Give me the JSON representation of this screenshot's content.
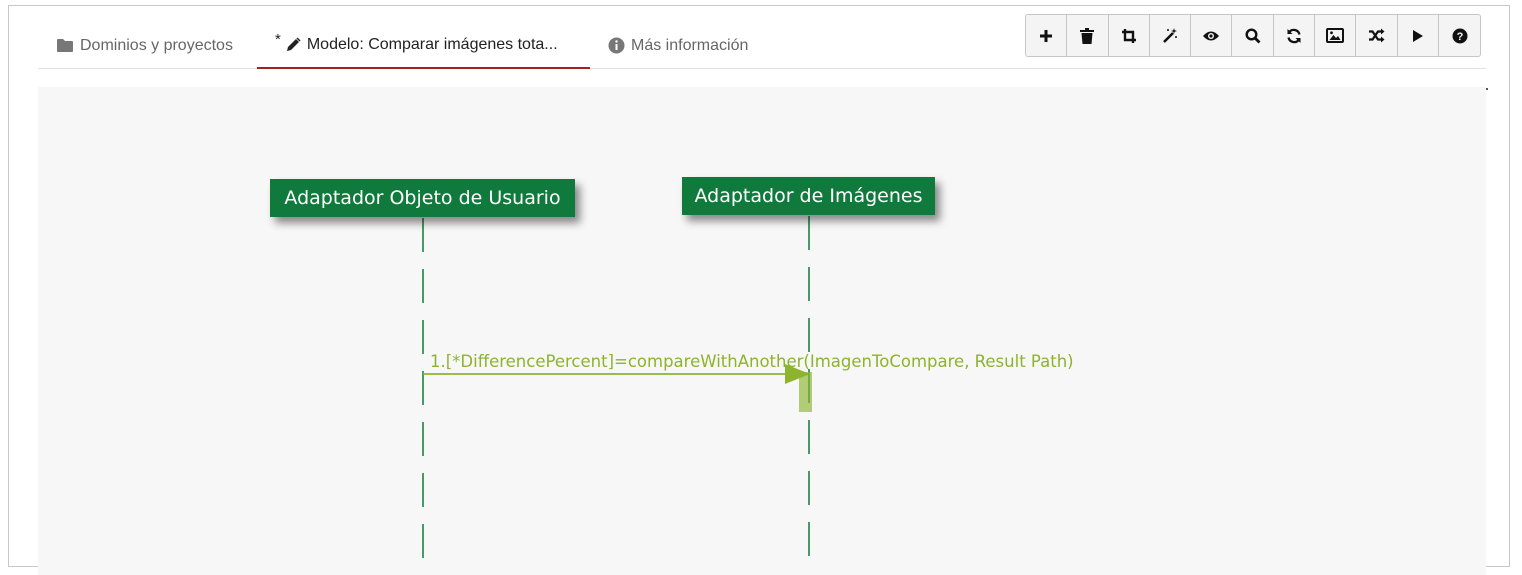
{
  "tabs": [
    {
      "label": "Dominios y proyectos",
      "icon": "folder-icon"
    },
    {
      "label": "Modelo: Comparar imágenes tota...",
      "icon": "pencil-icon",
      "modified_marker": "*"
    },
    {
      "label": "Más información",
      "icon": "info-icon"
    }
  ],
  "toolbar": [
    {
      "icon": "plus-icon"
    },
    {
      "icon": "trash-icon"
    },
    {
      "icon": "crop-icon"
    },
    {
      "icon": "magic-wand-icon"
    },
    {
      "icon": "eye-icon"
    },
    {
      "icon": "search-icon"
    },
    {
      "icon": "refresh-icon"
    },
    {
      "icon": "image-icon"
    },
    {
      "icon": "shuffle-icon"
    },
    {
      "icon": "play-icon"
    },
    {
      "icon": "help-icon"
    }
  ],
  "diagram": {
    "lifelines": [
      {
        "label": "Adaptador Objeto de Usuario"
      },
      {
        "label": "Adaptador de Imágenes"
      }
    ],
    "message": {
      "label": "1.[*DifferencePercent]=compareWithAnother(ImagenToCompare, Result Path)"
    },
    "colors": {
      "lifeline": "#0f7a3c",
      "message": "#8db32f"
    }
  }
}
